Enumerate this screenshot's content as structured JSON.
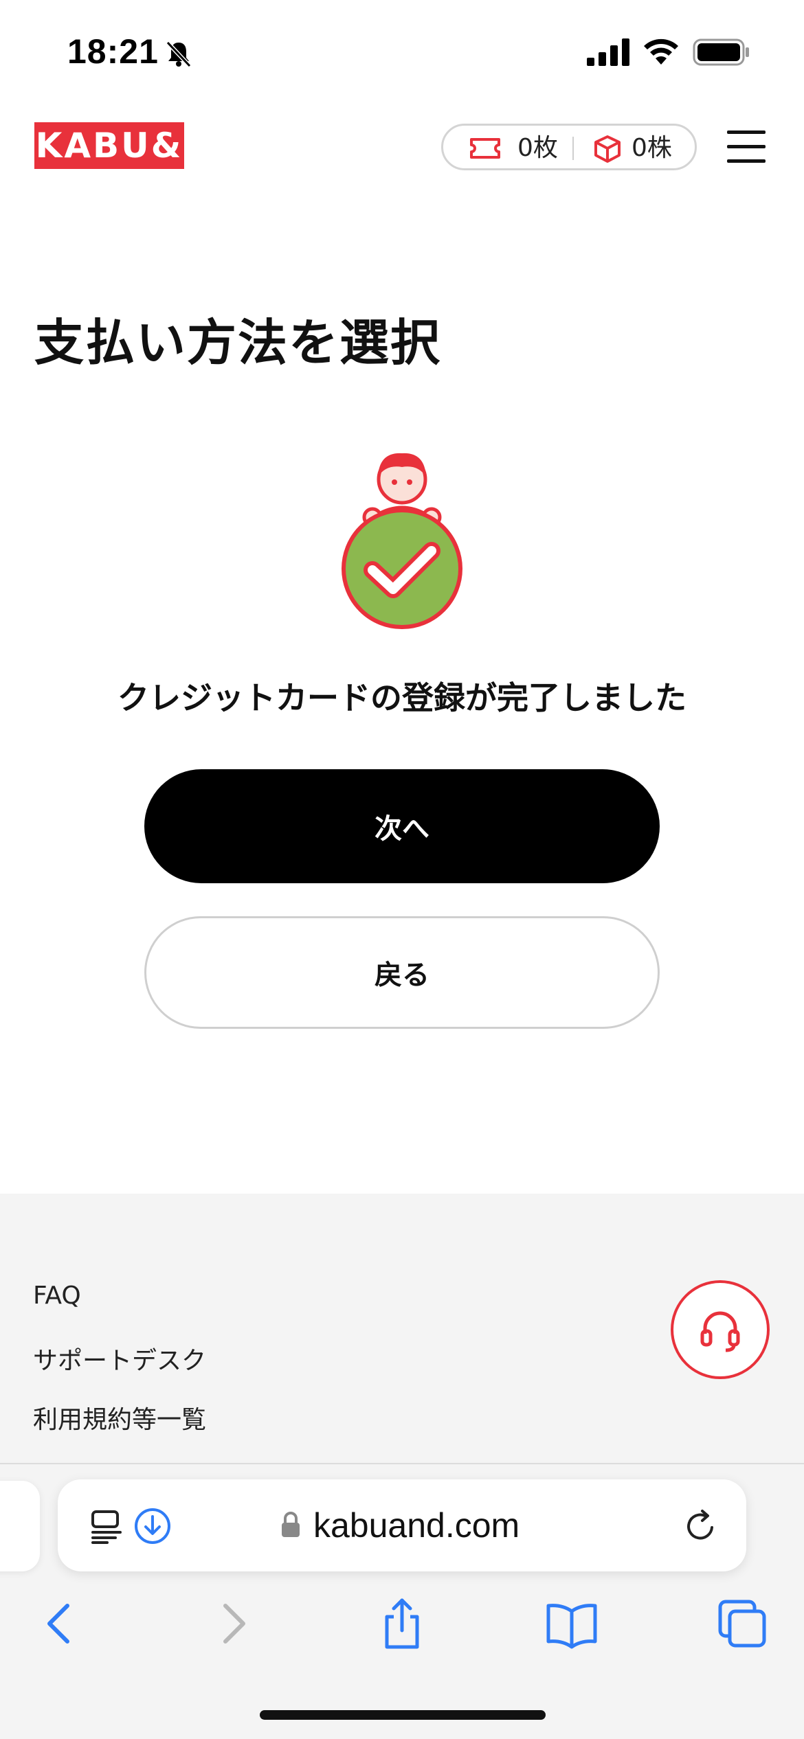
{
  "status_bar": {
    "time": "18:21",
    "icons": [
      "bell-muted-icon",
      "signal-icon",
      "wifi-icon",
      "battery-icon"
    ]
  },
  "header": {
    "logo_text": "KABU&",
    "ticket_count": "0枚",
    "stock_count": "0株",
    "icons": [
      "ticket-icon",
      "box-icon",
      "menu-icon"
    ]
  },
  "main": {
    "title": "支払い方法を選択",
    "success_message": "クレジットカードの登録が完了しました",
    "next_label": "次へ",
    "back_label": "戻る"
  },
  "footer": {
    "links": [
      "FAQ",
      "サポートデスク",
      "利用規約等一覧"
    ],
    "support_icon": "headset-icon"
  },
  "browser": {
    "url": "kabuand.com",
    "toolbar_icons": [
      "back-icon",
      "forward-icon",
      "share-icon",
      "bookmarks-icon",
      "tabs-icon"
    ]
  },
  "colors": {
    "brand_red": "#e8313b",
    "success_green": "#8cb84f",
    "safari_blue": "#2f7cf6",
    "button_black": "#000000"
  }
}
